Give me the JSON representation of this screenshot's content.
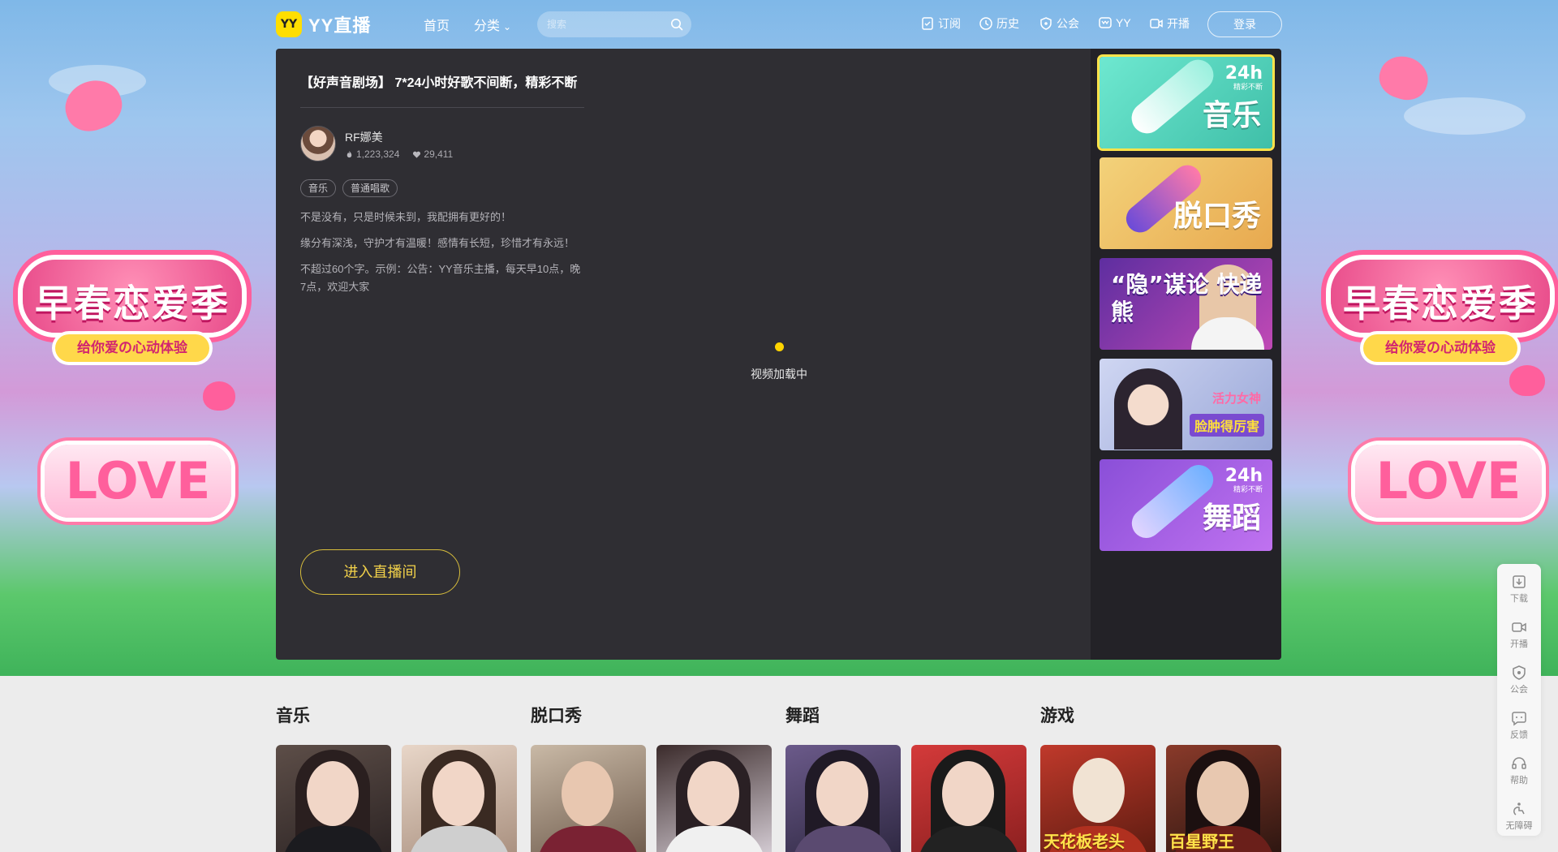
{
  "nav": {
    "logo_badge": "YY",
    "logo_text": "YY直播",
    "home": "首页",
    "category": "分类",
    "search_placeholder": "搜索",
    "subscribe": "订阅",
    "history": "历史",
    "guild": "公会",
    "yy": "YY",
    "start_live": "开播",
    "login": "登录"
  },
  "hero": {
    "deco_title": "早春恋爱季",
    "deco_subtitle": "给你爱の心动体验",
    "love_text": "LOVE"
  },
  "player": {
    "room_title": "【好声音剧场】 7*24小时好歌不间断，精彩不断",
    "anchor_name": "RF娜美",
    "heat": "1,223,324",
    "likes": "29,411",
    "tags": [
      "音乐",
      "普通唱歌"
    ],
    "desc": [
      "不是没有，只是时候未到，我配拥有更好的！",
      "缘分有深浅，守护才有温暖！感情有长短，珍惜才有永远！",
      "不超过60个字。示例：公告：YY音乐主播，每天早10点，晚7点，欢迎大家"
    ],
    "loading_text": "视频加载中",
    "enter_button": "进入直播间"
  },
  "side_cards": [
    {
      "text": "音乐",
      "badge": "24h",
      "badge_sub": "精彩不断"
    },
    {
      "text": "脱口秀"
    },
    {
      "text": "“隐”谋论 快递熊"
    },
    {
      "text1": "活力女神",
      "text2": "脸肿得厉害"
    },
    {
      "text": "舞蹈",
      "badge": "24h",
      "badge_sub": "精彩不断"
    }
  ],
  "sections": [
    {
      "title": "音乐"
    },
    {
      "title": "脱口秀"
    },
    {
      "title": "舞蹈"
    },
    {
      "title": "游戏",
      "thumb_texts": [
        "天花板老头",
        "百星野王"
      ]
    }
  ],
  "float_bar": [
    "下载",
    "开播",
    "公会",
    "反馈",
    "帮助",
    "无障碍"
  ],
  "colors": {
    "accent_yellow": "#ffde00",
    "player_bg": "#2f2e33",
    "enter_button_border": "#d7bd3c"
  }
}
